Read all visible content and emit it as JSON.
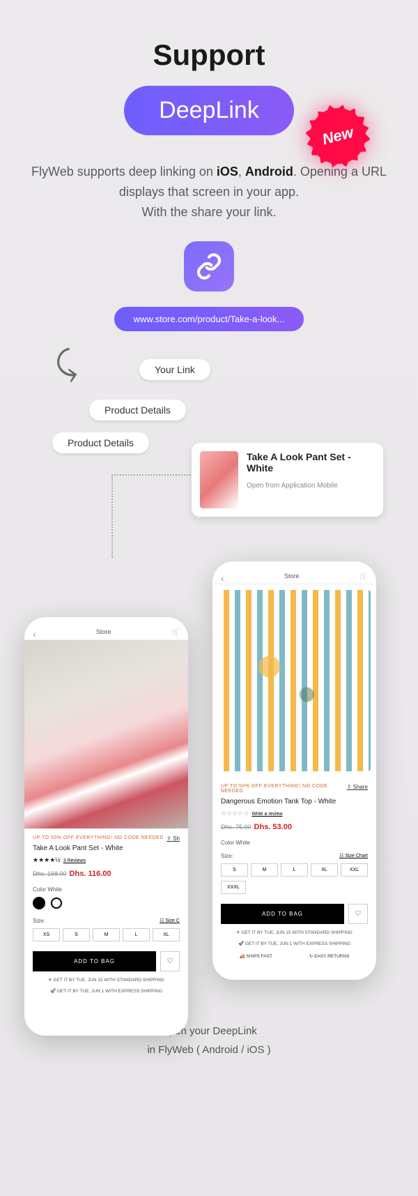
{
  "header": {
    "title": "Support",
    "pill": "DeepLink",
    "badge": "New"
  },
  "description": {
    "line1_pre": "FlyWeb supports deep linking on ",
    "ios": "iOS",
    "sep": ", ",
    "android": "Android",
    "line1_post": ". Opening a URL displays that screen in your app.",
    "line2": "With the share your link."
  },
  "url": "www.store.com/product/Take-a-look...",
  "chips": {
    "c1": "Your Link",
    "c2": "Product Details",
    "c3": "Product Details"
  },
  "card": {
    "title": "Take A Look Pant Set - White",
    "sub": "Open from Application Mobile"
  },
  "phoneLeft": {
    "store": "Store",
    "promo": "UP TO 50% OFF EVERYTHING! NO CODE NEEDED",
    "share": "Sh",
    "title": "Take A Look Pant Set - White",
    "stars": "★★★★½",
    "reviews": "3 Reviews",
    "oldPrice": "Dhs. 168.00",
    "newPrice": "Dhs. 116.00",
    "colorLabel": "Color White",
    "sizeLabel": "Size:",
    "sizeChart": "Size C",
    "sizes": [
      "XS",
      "S",
      "M",
      "L",
      "XL"
    ],
    "addBag": "ADD TO BAG",
    "ship1": "✈ GET IT BY TUE, JUN 15 WITH STANDARD SHIPPING",
    "ship2": "🚀 GET IT BY TUE, JUN 1 WITH EXPRESS SHIPPING"
  },
  "phoneRight": {
    "store": "Store",
    "promo": "UP TO 50% OFF EVERYTHING! NO CODE NEEDED",
    "share": "Share",
    "title": "Dangerous Emotion Tank Top - White",
    "stars": "☆☆☆☆☆",
    "reviews": "Write a review",
    "oldPrice": "Dhs. 75.00",
    "newPrice": "Dhs. 53.00",
    "colorLabel": "Color White",
    "sizeLabel": "Size:",
    "sizeChart": "Size Chart",
    "sizes": [
      "S",
      "M",
      "L",
      "XL",
      "XXL",
      "XXXL"
    ],
    "addBag": "ADD TO BAG",
    "ship1": "✈ GET IT BY TUE, JUN 15 WITH STANDARD SHIPPING",
    "ship2": "🚀 GET IT BY TUE, JUN 1 WITH EXPRESS SHIPPING",
    "badge1": "🚚 SHIPS FAST",
    "badge2": "↻ EASY RETURNS"
  },
  "footer": {
    "l1": "Open your DeepLink",
    "l2": "in FlyWeb ( Android / iOS )"
  }
}
